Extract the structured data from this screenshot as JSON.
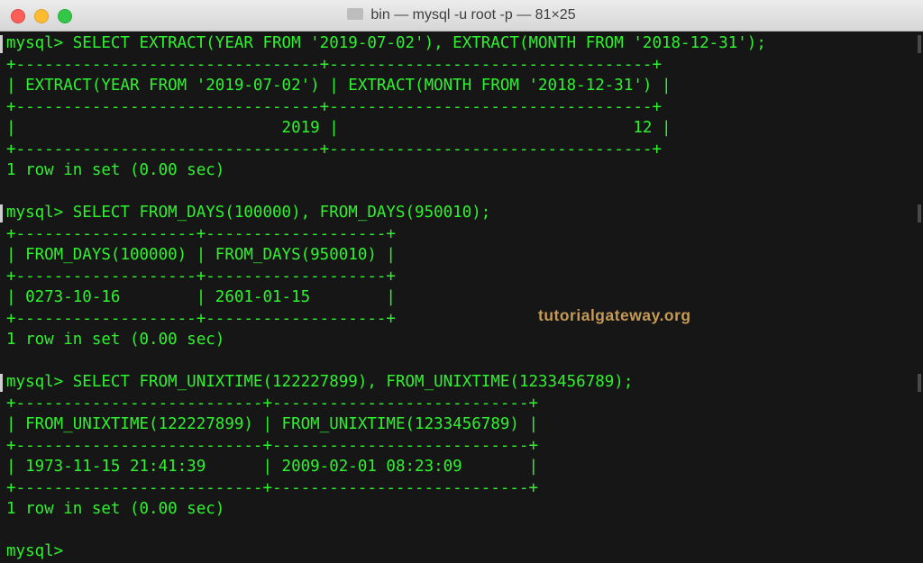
{
  "window": {
    "title": "bin — mysql -u root -p — 81×25"
  },
  "terminal": {
    "text_color": "#2ff22f",
    "background": "#161616",
    "lines": [
      "mysql> SELECT EXTRACT(YEAR FROM '2019-07-02'), EXTRACT(MONTH FROM '2018-12-31');",
      "+--------------------------------+----------------------------------+",
      "| EXTRACT(YEAR FROM '2019-07-02') | EXTRACT(MONTH FROM '2018-12-31') |",
      "+--------------------------------+----------------------------------+",
      "|                            2019 |                               12 |",
      "+--------------------------------+----------------------------------+",
      "1 row in set (0.00 sec)",
      "",
      "mysql> SELECT FROM_DAYS(100000), FROM_DAYS(950010);",
      "+-------------------+-------------------+",
      "| FROM_DAYS(100000) | FROM_DAYS(950010) |",
      "+-------------------+-------------------+",
      "| 0273-10-16        | 2601-01-15        |",
      "+-------------------+-------------------+",
      "1 row in set (0.00 sec)",
      "",
      "mysql> SELECT FROM_UNIXTIME(122227899), FROM_UNIXTIME(1233456789);",
      "+--------------------------+---------------------------+",
      "| FROM_UNIXTIME(122227899) | FROM_UNIXTIME(1233456789) |",
      "+--------------------------+---------------------------+",
      "| 1973-11-15 21:41:39      | 2009-02-01 08:23:09       |",
      "+--------------------------+---------------------------+",
      "1 row in set (0.00 sec)",
      "",
      "mysql> "
    ]
  },
  "watermark": {
    "text": "tutorialgateway.org",
    "color": "#c59a55"
  }
}
